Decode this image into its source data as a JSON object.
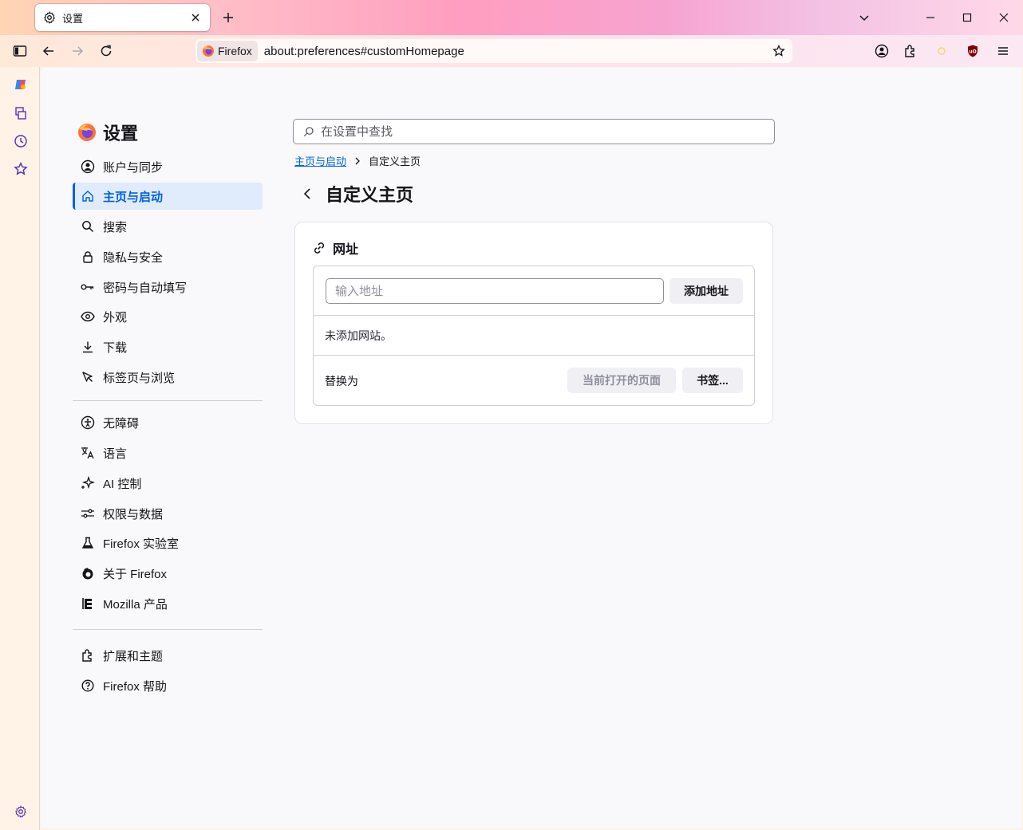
{
  "tab": {
    "title": "设置"
  },
  "urlbar": {
    "identity_label": "Firefox",
    "url": "about:preferences#customHomepage"
  },
  "sidebar_header": {
    "title": "设置"
  },
  "categories": [
    {
      "label": "账户与同步",
      "icon": "account-icon"
    },
    {
      "label": "主页与启动",
      "icon": "home-icon",
      "selected": true
    },
    {
      "label": "搜索",
      "icon": "search-icon"
    },
    {
      "label": "隐私与安全",
      "icon": "lock-icon"
    },
    {
      "label": "密码与自动填写",
      "icon": "key-icon"
    },
    {
      "label": "外观",
      "icon": "eye-icon"
    },
    {
      "label": "下载",
      "icon": "download-icon"
    },
    {
      "label": "标签页与浏览",
      "icon": "cursor-icon"
    }
  ],
  "categories2": [
    {
      "label": "无障碍",
      "icon": "accessibility-icon"
    },
    {
      "label": "语言",
      "icon": "translate-icon"
    },
    {
      "label": "AI 控制",
      "icon": "sparkle-icon"
    },
    {
      "label": "权限与数据",
      "icon": "sliders-icon"
    },
    {
      "label": "Firefox 实验室",
      "icon": "flask-icon"
    },
    {
      "label": "关于 Firefox",
      "icon": "firefox-icon"
    },
    {
      "label": "Mozilla 产品",
      "icon": "flag-icon"
    }
  ],
  "categories3": [
    {
      "label": "扩展和主题",
      "icon": "puzzle-icon"
    },
    {
      "label": "Firefox 帮助",
      "icon": "help-icon"
    }
  ],
  "search": {
    "placeholder": "在设置中查找"
  },
  "breadcrumb": {
    "parent": "主页与启动",
    "current": "自定义主页"
  },
  "page": {
    "title": "自定义主页"
  },
  "card": {
    "title": "网址",
    "address_placeholder": "输入地址",
    "add_button": "添加地址",
    "empty_text": "未添加网站。",
    "replace_label": "替换为",
    "current_pages_button": "当前打开的页面",
    "bookmarks_button": "书签..."
  },
  "colors": {
    "accent": "#0061e0",
    "selected_bg": "#e0ecfc"
  }
}
